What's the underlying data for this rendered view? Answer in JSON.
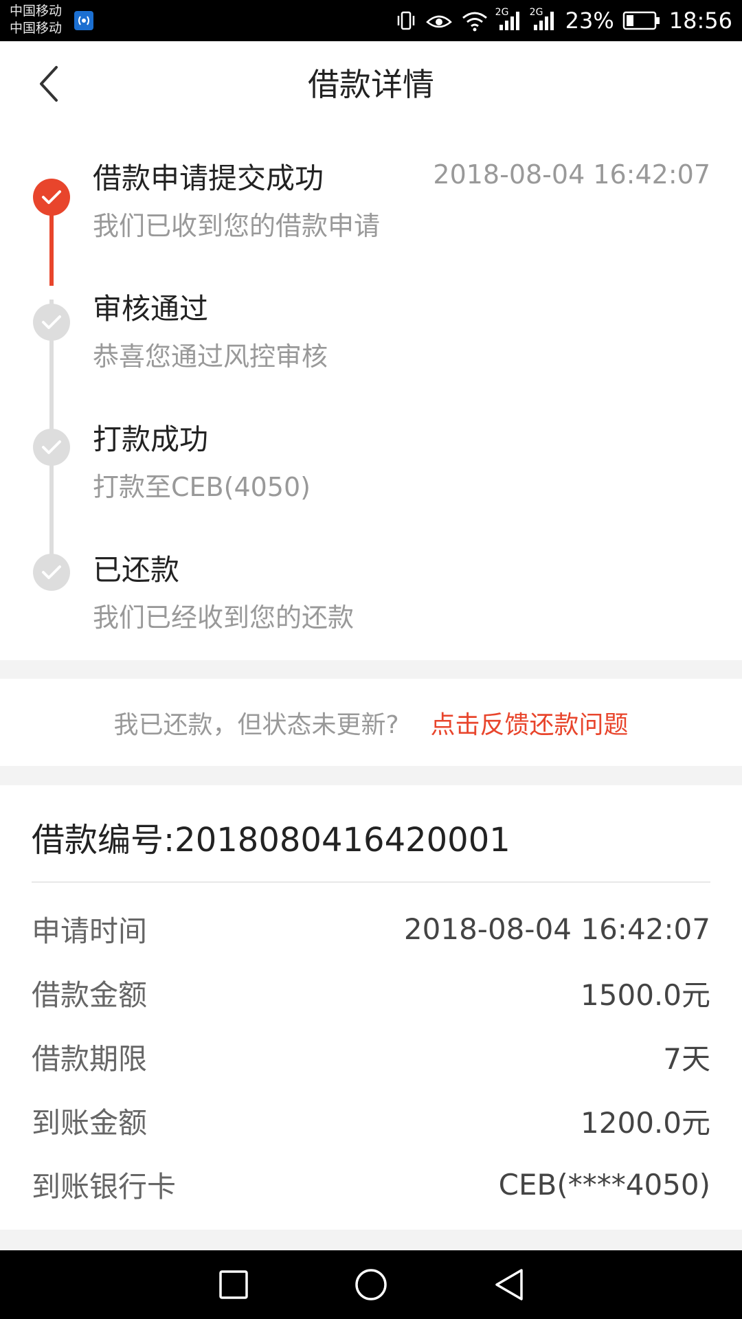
{
  "status_bar": {
    "carrier_1": "中国移动",
    "carrier_2": "中国移动",
    "network_1": "2G",
    "network_2": "2G",
    "battery": "23%",
    "time": "18:56"
  },
  "header": {
    "title": "借款详情"
  },
  "timeline": {
    "steps": [
      {
        "title": "借款申请提交成功",
        "desc": "我们已收到您的借款申请",
        "time": "2018-08-04 16:42:07",
        "done": true
      },
      {
        "title": "审核通过",
        "desc": "恭喜您通过风控审核",
        "time": "",
        "done": false
      },
      {
        "title": "打款成功",
        "desc": "打款至CEB(4050)",
        "time": "",
        "done": false
      },
      {
        "title": "已还款",
        "desc": "我们已经收到您的还款",
        "time": "",
        "done": false
      }
    ]
  },
  "feedback": {
    "question": "我已还款，但状态未更新?",
    "link": "点击反馈还款问题"
  },
  "details": {
    "loan_number": "借款编号:2018080416420001",
    "rows": [
      {
        "label": "申请时间",
        "value": "2018-08-04 16:42:07"
      },
      {
        "label": "借款金额",
        "value": "1500.0元"
      },
      {
        "label": "借款期限",
        "value": "7天"
      },
      {
        "label": "到账金额",
        "value": "1200.0元"
      },
      {
        "label": "到账银行卡",
        "value": "CEB(****4050)"
      }
    ]
  },
  "colors": {
    "accent": "#e8452c",
    "inactive": "#dddddd"
  },
  "icons": {
    "back": "chevron-left-icon",
    "check": "check-icon",
    "nav_recent": "square-icon",
    "nav_home": "circle-icon",
    "nav_back": "triangle-back-icon"
  }
}
